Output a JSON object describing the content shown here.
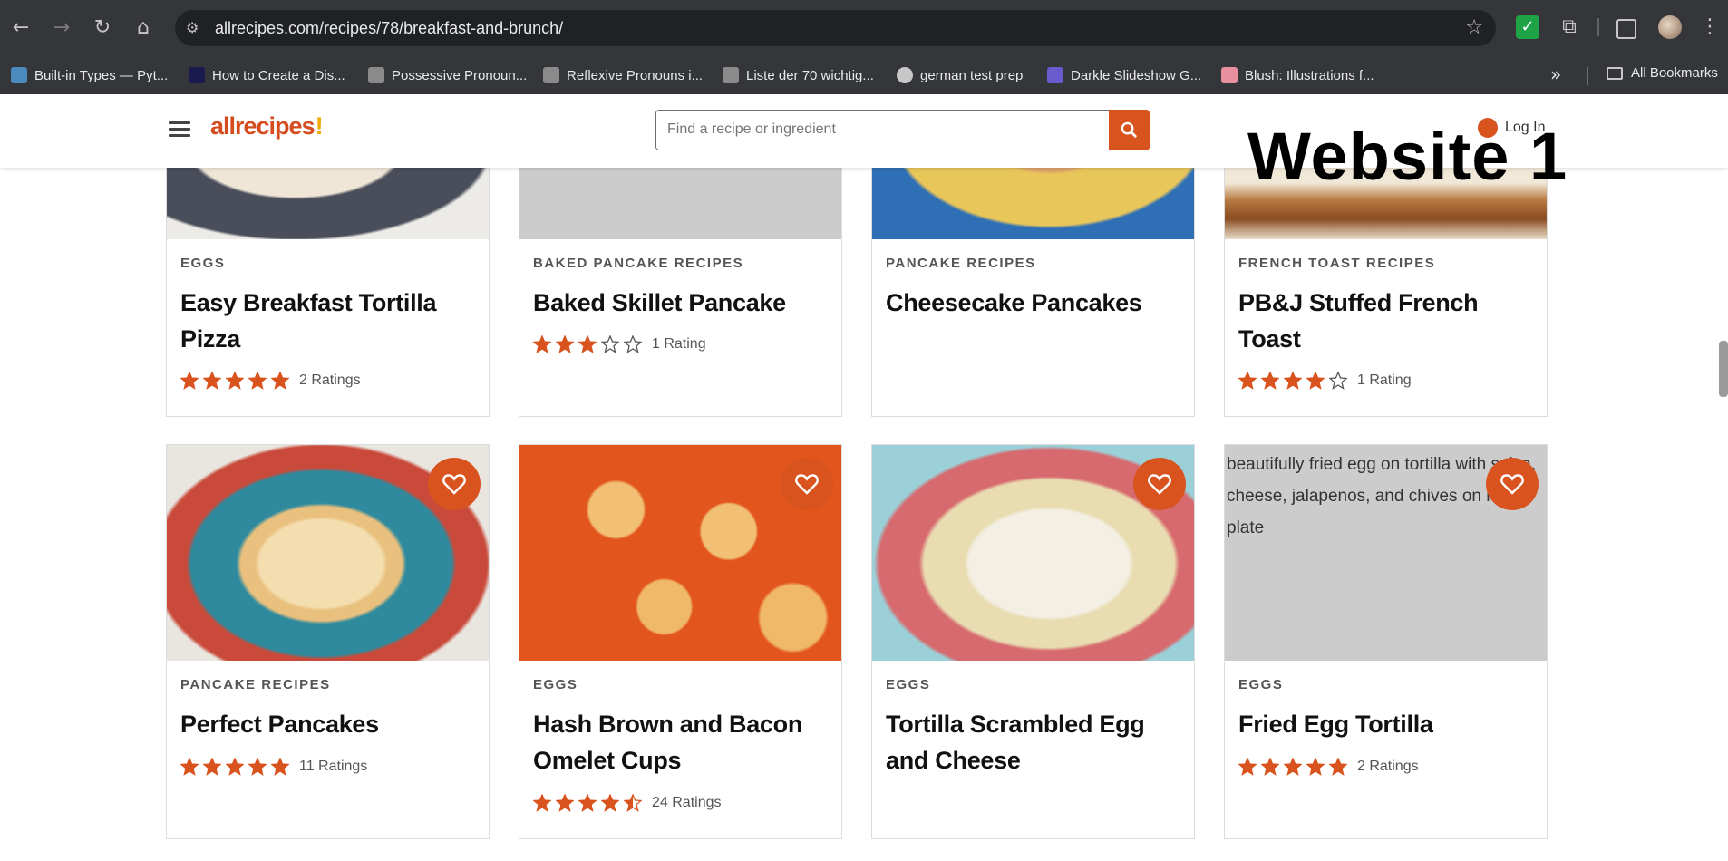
{
  "browser": {
    "url": "allrecipes.com/recipes/78/breakfast-and-brunch/",
    "bookmarks": [
      {
        "label": "Built-in Types — Pyt...",
        "icon": "python-icon",
        "color": "#4b8bbe"
      },
      {
        "label": "How to Create a Dis...",
        "icon": "a-logo-icon",
        "color": "#1a1a4e"
      },
      {
        "label": "Possessive Pronoun...",
        "icon": "hammer-icon",
        "color": "#9a9a9a"
      },
      {
        "label": "Reflexive Pronouns i...",
        "icon": "hammer-icon",
        "color": "#9a9a9a"
      },
      {
        "label": "Liste der 70 wichtig...",
        "icon": "hammer-icon",
        "color": "#9a9a9a"
      },
      {
        "label": "german test prep",
        "icon": "globe-icon",
        "color": "#c7c7c7"
      },
      {
        "label": "Darkle Slideshow G...",
        "icon": "cube-icon",
        "color": "#6a5acd"
      },
      {
        "label": "Blush: Illustrations f...",
        "icon": "blush-icon",
        "color": "#e88fa0"
      }
    ],
    "all_bookmarks": "All Bookmarks"
  },
  "site": {
    "logo": "allrecipes",
    "search_placeholder": "Find a recipe or ingredient",
    "login": "Log In",
    "overlay": "Website 1",
    "accent_color": "#d9531e"
  },
  "cards_row1": [
    {
      "category": "EGGS",
      "title": "Easy Breakfast Tortilla Pizza",
      "rating": 5,
      "ratings_text": "2 Ratings"
    },
    {
      "category": "BAKED PANCAKE RECIPES",
      "title": "Baked Skillet Pancake",
      "rating": 3,
      "ratings_text": "1 Rating"
    },
    {
      "category": "PANCAKE RECIPES",
      "title": "Cheesecake Pancakes",
      "rating": 0,
      "ratings_text": ""
    },
    {
      "category": "FRENCH TOAST RECIPES",
      "title": "PB&J Stuffed French Toast",
      "rating": 4,
      "ratings_text": "1 Rating"
    }
  ],
  "cards_row2": [
    {
      "category": "PANCAKE RECIPES",
      "title": "Perfect Pancakes",
      "rating": 5,
      "ratings_text": "11 Ratings"
    },
    {
      "category": "EGGS",
      "title": "Hash Brown and Bacon Omelet Cups",
      "rating": 4.5,
      "ratings_text": "24 Ratings"
    },
    {
      "category": "EGGS",
      "title": "Tortilla Scrambled Egg and Cheese",
      "rating": 0,
      "ratings_text": ""
    },
    {
      "category": "EGGS",
      "title": "Fried Egg Tortilla",
      "rating": 5,
      "ratings_text": "2 Ratings",
      "img_alt": "beautifully fried egg on tortilla with salsa, cheese, jalapenos, and chives on red plate"
    }
  ]
}
